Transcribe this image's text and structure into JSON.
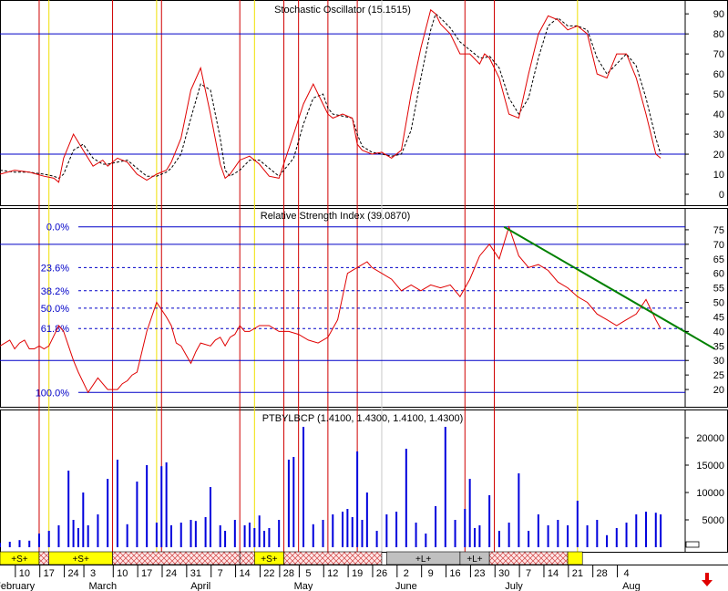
{
  "chart_data": [
    {
      "type": "line",
      "title": "Stochastic Oscillator (15.1515)",
      "y_ticks": [
        0,
        10,
        20,
        30,
        40,
        50,
        60,
        70,
        80,
        90
      ],
      "ylim": [
        -5,
        96
      ],
      "reference_lines": [
        20,
        80
      ],
      "series": [
        {
          "style": "solid red",
          "x": [
            0,
            3,
            6,
            9,
            11,
            12,
            13,
            15,
            17,
            19,
            21,
            22,
            24,
            26,
            28,
            30,
            32,
            34,
            35,
            37,
            39,
            41,
            43,
            45,
            46,
            47,
            49,
            51,
            53,
            55,
            57,
            60,
            62,
            64,
            66,
            67,
            68,
            70,
            72,
            73,
            74,
            76,
            78,
            80,
            82,
            84,
            86,
            88,
            89,
            90,
            92,
            94,
            96,
            98,
            99,
            100,
            102,
            104,
            106,
            108,
            110,
            112,
            114,
            116,
            118,
            120,
            122,
            124,
            126,
            128,
            130,
            132,
            134,
            135
          ],
          "values": [
            10,
            12,
            11,
            9,
            8,
            6,
            18,
            30,
            22,
            14,
            17,
            14,
            18,
            16,
            10,
            7,
            10,
            12,
            16,
            28,
            52,
            63,
            40,
            15,
            8,
            10,
            17,
            19,
            15,
            9,
            8,
            30,
            45,
            55,
            45,
            40,
            38,
            40,
            38,
            25,
            22,
            20,
            21,
            18,
            22,
            50,
            73,
            92,
            90,
            85,
            80,
            70,
            70,
            65,
            70,
            68,
            58,
            40,
            38,
            60,
            80,
            89,
            87,
            82,
            84,
            80,
            60,
            58,
            70,
            70,
            58,
            40,
            20,
            18
          ]
        },
        {
          "style": "dashed black",
          "x": [
            0,
            3,
            6,
            9,
            11,
            12,
            13,
            15,
            17,
            19,
            21,
            22,
            24,
            26,
            28,
            30,
            32,
            34,
            35,
            37,
            39,
            41,
            43,
            45,
            46,
            47,
            49,
            51,
            53,
            55,
            57,
            60,
            62,
            64,
            66,
            67,
            68,
            70,
            72,
            73,
            74,
            76,
            78,
            80,
            82,
            84,
            86,
            88,
            89,
            90,
            92,
            94,
            96,
            98,
            99,
            100,
            102,
            104,
            106,
            108,
            110,
            112,
            114,
            116,
            118,
            120,
            122,
            124,
            126,
            128,
            130,
            132,
            134,
            135
          ],
          "values": [
            12,
            11,
            11,
            10,
            9,
            8,
            10,
            22,
            25,
            18,
            15,
            15,
            16,
            17,
            13,
            9,
            9,
            11,
            13,
            20,
            38,
            55,
            52,
            28,
            12,
            9,
            12,
            17,
            17,
            13,
            9,
            18,
            35,
            48,
            50,
            43,
            40,
            39,
            38,
            30,
            24,
            21,
            20,
            19,
            20,
            32,
            58,
            82,
            90,
            88,
            83,
            76,
            72,
            68,
            68,
            69,
            63,
            48,
            40,
            48,
            68,
            84,
            88,
            84,
            84,
            82,
            68,
            60,
            65,
            70,
            64,
            48,
            28,
            20
          ]
        }
      ]
    },
    {
      "type": "line",
      "title": "Relative Strength Index (39.0870)",
      "y_ticks": [
        20,
        25,
        30,
        35,
        40,
        45,
        50,
        55,
        60,
        65,
        70,
        75
      ],
      "ylim": [
        15,
        80
      ],
      "reference_lines": [
        30,
        70
      ],
      "fibonacci_levels": [
        {
          "label": "0.0%",
          "value": 76
        },
        {
          "label": "23.6%",
          "value": 62
        },
        {
          "label": "38.2%",
          "value": 54
        },
        {
          "label": "50.0%",
          "value": 48
        },
        {
          "label": "61.8%",
          "value": 41
        },
        {
          "label": "100.0%",
          "value": 19
        }
      ],
      "trendline": {
        "x": [
          103,
          146
        ],
        "values": [
          76,
          34
        ]
      },
      "series": [
        {
          "style": "solid red",
          "x": [
            0,
            2,
            3,
            4,
            5,
            6,
            7,
            8,
            9,
            10,
            12,
            13,
            14,
            15,
            16,
            18,
            20,
            22,
            24,
            25,
            26,
            27,
            28,
            30,
            32,
            34,
            35,
            36,
            37,
            38,
            39,
            40,
            41,
            43,
            44,
            45,
            46,
            47,
            48,
            49,
            50,
            51,
            53,
            55,
            57,
            59,
            61,
            63,
            65,
            67,
            69,
            71,
            73,
            75,
            76,
            78,
            80,
            82,
            84,
            86,
            88,
            90,
            92,
            94,
            96,
            98,
            100,
            102,
            104,
            106,
            108,
            110,
            112,
            114,
            116,
            118,
            120,
            122,
            124,
            126,
            128,
            130,
            132,
            134,
            135
          ],
          "values": [
            35,
            37,
            34,
            36,
            37,
            34,
            34,
            35,
            34,
            35,
            42,
            40,
            35,
            30,
            26,
            19,
            24,
            20,
            20,
            22,
            23,
            25,
            26,
            40,
            50,
            45,
            42,
            36,
            35,
            32,
            29,
            33,
            36,
            35,
            37,
            38,
            35,
            38,
            39,
            42,
            40,
            40,
            42,
            42,
            40,
            40,
            39,
            37,
            36,
            38,
            44,
            60,
            62,
            64,
            62,
            60,
            58,
            54,
            56,
            54,
            56,
            55,
            56,
            52,
            58,
            66,
            70,
            65,
            76,
            66,
            62,
            63,
            61,
            57,
            55,
            52,
            50,
            46,
            44,
            42,
            44,
            46,
            51,
            44,
            41
          ]
        }
      ]
    },
    {
      "type": "bar",
      "title": "PTBYLBCP (1.4100, 1.4300, 1.4100, 1.4300)",
      "y_ticks": [
        5000,
        10000,
        15000,
        20000
      ],
      "ylim": [
        0,
        25000
      ],
      "x": [
        0,
        2,
        4,
        6,
        8,
        10,
        12,
        14,
        15,
        16,
        17,
        18,
        20,
        22,
        24,
        26,
        28,
        30,
        32,
        33,
        34,
        35,
        37,
        39,
        40,
        42,
        43,
        45,
        46,
        48,
        50,
        51,
        52,
        53,
        54,
        55,
        57,
        59,
        60,
        62,
        64,
        66,
        68,
        70,
        71,
        72,
        73,
        74,
        75,
        77,
        79,
        81,
        83,
        85,
        87,
        89,
        91,
        93,
        95,
        96,
        97,
        98,
        100,
        102,
        104,
        106,
        108,
        110,
        112,
        114,
        116,
        118,
        120,
        122,
        124,
        126,
        128,
        130,
        132,
        134,
        135
      ],
      "values": [
        800,
        1000,
        1300,
        1200,
        2500,
        3000,
        4000,
        14000,
        5000,
        3500,
        10000,
        4000,
        6000,
        12500,
        16000,
        4200,
        12000,
        15000,
        4500,
        14800,
        15500,
        4000,
        4500,
        5000,
        4800,
        5500,
        11000,
        4000,
        3000,
        5000,
        4000,
        4500,
        3500,
        5800,
        3000,
        3500,
        5000,
        16000,
        16500,
        22000,
        4200,
        5000,
        6000,
        6500,
        7000,
        5500,
        17500,
        5000,
        10000,
        3000,
        6000,
        6500,
        18000,
        4500,
        2500,
        7500,
        22000,
        5000,
        7000,
        12500,
        3500,
        4000,
        9500,
        3000,
        4500,
        13500,
        3000,
        6000,
        4000,
        5000,
        4000,
        8500,
        4000,
        5000,
        2200,
        3500,
        4500,
        6000,
        6500,
        6300,
        6000
      ]
    }
  ],
  "signal_bands": [
    {
      "label": "+S+",
      "x_start": 0,
      "x_end": 8,
      "fill": "yellow"
    },
    {
      "label": "",
      "x_start": 8,
      "x_end": 10,
      "fill": "hatched"
    },
    {
      "label": "+S+",
      "x_start": 10,
      "x_end": 23,
      "fill": "yellow"
    },
    {
      "label": "",
      "x_start": 23,
      "x_end": 49,
      "fill": "hatched"
    },
    {
      "label": "",
      "x_start": 49,
      "x_end": 52,
      "fill": "hatched"
    },
    {
      "label": "+S+",
      "x_start": 52,
      "x_end": 58,
      "fill": "yellow"
    },
    {
      "label": "",
      "x_start": 58,
      "x_end": 78,
      "fill": "hatched"
    },
    {
      "label": "+L+",
      "x_start": 79,
      "x_end": 94,
      "fill": "grey"
    },
    {
      "label": "+L+",
      "x_start": 94,
      "x_end": 100,
      "fill": "grey"
    },
    {
      "label": "",
      "x_start": 100,
      "x_end": 116,
      "fill": "hatched"
    },
    {
      "label": "",
      "x_start": 116,
      "x_end": 119,
      "fill": "yellow"
    }
  ],
  "x_day_ticks": [
    {
      "label": "10",
      "x": 5
    },
    {
      "label": "17",
      "x": 10
    },
    {
      "label": "24",
      "x": 15
    },
    {
      "label": "3",
      "x": 19
    },
    {
      "label": "10",
      "x": 25
    },
    {
      "label": "17",
      "x": 30
    },
    {
      "label": "24",
      "x": 35
    },
    {
      "label": "31",
      "x": 40
    },
    {
      "label": "7",
      "x": 45
    },
    {
      "label": "14",
      "x": 50
    },
    {
      "label": "22",
      "x": 55
    },
    {
      "label": "28",
      "x": 59
    },
    {
      "label": "5",
      "x": 63
    },
    {
      "label": "12",
      "x": 68
    },
    {
      "label": "19",
      "x": 73
    },
    {
      "label": "26",
      "x": 78
    },
    {
      "label": "2",
      "x": 83
    },
    {
      "label": "9",
      "x": 88
    },
    {
      "label": "16",
      "x": 93
    },
    {
      "label": "23",
      "x": 98
    },
    {
      "label": "30",
      "x": 103
    },
    {
      "label": "7",
      "x": 108
    },
    {
      "label": "14",
      "x": 113
    },
    {
      "label": "21",
      "x": 118
    },
    {
      "label": "28",
      "x": 123
    },
    {
      "label": "4",
      "x": 128
    }
  ],
  "x_month_labels": [
    {
      "label": "February",
      "x": 3
    },
    {
      "label": "March",
      "x": 21
    },
    {
      "label": "April",
      "x": 41
    },
    {
      "label": "May",
      "x": 62
    },
    {
      "label": "June",
      "x": 83
    },
    {
      "label": "July",
      "x": 105
    },
    {
      "label": "Aug",
      "x": 129
    }
  ],
  "red_verticals": [
    8,
    23,
    33,
    49,
    58,
    61,
    67,
    73,
    95,
    101
  ],
  "yellow_verticals": [
    10,
    32,
    52,
    118
  ],
  "grey_verticals": [
    78
  ],
  "colors": {
    "primary_line": "#e00000",
    "reference": "#0000c8",
    "trendline": "#008000",
    "volume_bar": "#0000dd",
    "signal_yellow": "#ffff00",
    "hatch": "#e06060"
  }
}
